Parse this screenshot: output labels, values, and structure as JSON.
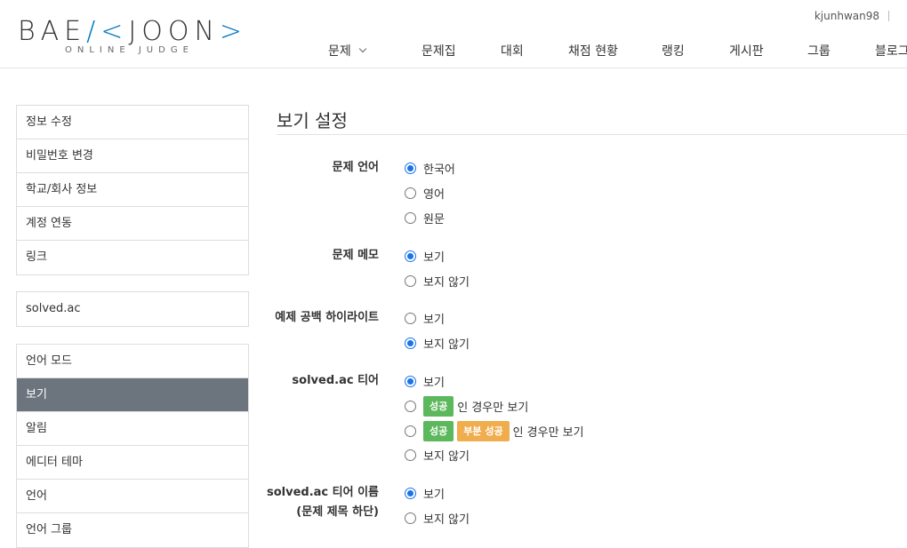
{
  "header": {
    "logo_left": "BAE",
    "logo_accent_open": "/<",
    "logo_right": "JOON",
    "logo_accent_close": ">",
    "logo_sub": "ONLINE JUDGE",
    "username": "kjunhwan98",
    "nav": [
      "문제",
      "문제집",
      "대회",
      "채점 현황",
      "랭킹",
      "게시판",
      "그룹",
      "블로그"
    ]
  },
  "sidebar": {
    "group1": [
      "정보 수정",
      "비밀번호 변경",
      "학교/회사 정보",
      "계정 연동",
      "링크"
    ],
    "group2": [
      "solved.ac"
    ],
    "group3": [
      "언어 모드",
      "보기",
      "알림",
      "에디터 테마",
      "언어",
      "언어 그룹"
    ],
    "active": "보기"
  },
  "main": {
    "title": "보기 설정",
    "settings": {
      "problem_language": {
        "label": "문제 언어",
        "options": [
          "한국어",
          "영어",
          "원문"
        ],
        "selected": "한국어"
      },
      "problem_memo": {
        "label": "문제 메모",
        "options": [
          "보기",
          "보지 않기"
        ],
        "selected": "보기"
      },
      "whitespace_highlight": {
        "label": "예제 공백 하이라이트",
        "options": [
          "보기",
          "보지 않기"
        ],
        "selected": "보지 않기"
      },
      "solvedac_tier": {
        "label": "solved.ac 티어",
        "option_show": "보기",
        "badge_success": "성공",
        "badge_partial": "부분 성공",
        "option_success_only_suffix": "인 경우만 보기",
        "option_success_partial_suffix": "인 경우만 보기",
        "option_hide": "보지 않기",
        "selected": "보기"
      },
      "solvedac_tier_name": {
        "label_line1": "solved.ac 티어 이름",
        "label_line2": "(문제 제목 하단)",
        "options": [
          "보기",
          "보지 않기"
        ],
        "selected": "보기"
      }
    }
  },
  "colors": {
    "accent": "#0076c0",
    "sidebar_active": "#6c757d",
    "radio_checked": "#1a73e8",
    "badge_success": "#5cb85c",
    "badge_partial": "#f0ad4e"
  }
}
